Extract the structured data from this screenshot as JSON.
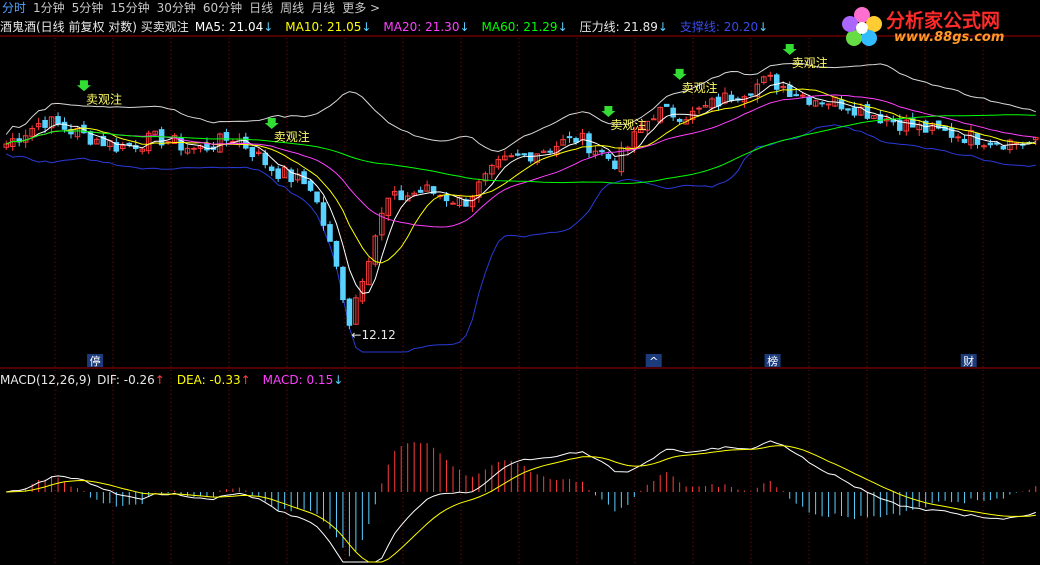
{
  "tabs": [
    "分时",
    "1分钟",
    "5分钟",
    "15分钟",
    "30分钟",
    "60分钟",
    "日线",
    "周线",
    "月线",
    "更多 >"
  ],
  "active_tab": "分时",
  "legend": {
    "security": "酒鬼酒(日线 前复权 对数) 买卖观注",
    "ma5": "MA5: 21.04",
    "ma10": "MA10: 21.05",
    "ma20": "MA20: 21.30",
    "ma60": "MA60: 21.29",
    "pressure": "压力线: 21.89",
    "support": "支撑线: 20.20"
  },
  "macd_legend": {
    "name": "MACD(12,26,9)",
    "dif": "DIF: -0.26",
    "dea": "DEA: -0.33",
    "macd": "MACD: 0.15"
  },
  "logo": {
    "name": "分析家公式网",
    "url": "www.88gs.com"
  },
  "colors": {
    "ma5": "#ffffff",
    "ma10": "#ffff00",
    "ma20": "#ff40ff",
    "ma60": "#00ff00",
    "upper_band": "#d8d8d8",
    "support": "#2a3ad8",
    "up": "#ff3b3b",
    "down": "#5ad2ff",
    "signal": "#33dd33",
    "axis": "#a00000"
  },
  "chart_data": [
    {
      "type": "candlestick",
      "title": "酒鬼酒(日线 前复权 对数) 买卖观注",
      "count": 160,
      "seed_path": [
        21.0,
        22.6,
        21.6,
        20.8,
        21.4,
        20.6,
        21.5,
        19.4,
        18.4,
        12.12,
        17.6,
        18.2,
        17.5,
        19.8,
        20.6,
        21.4,
        19.8,
        23.2,
        23.0,
        24.4,
        25.6,
        24.3,
        23.8,
        22.8,
        22.0,
        21.6,
        21.2,
        21.0
      ],
      "min_label": "←12.12",
      "signal_label": "卖观注",
      "signal_positions": [
        13,
        45,
        102,
        114,
        132
      ],
      "bottom_markers": [
        {
          "label": "停",
          "pos": 16
        },
        {
          "label": "^",
          "pos": 110
        },
        {
          "label": "榜",
          "pos": 130
        },
        {
          "label": "财",
          "pos": 163
        }
      ],
      "series": [
        {
          "name": "MA5"
        },
        {
          "name": "MA10"
        },
        {
          "name": "MA20"
        },
        {
          "name": "MA60"
        },
        {
          "name": "压力线"
        },
        {
          "name": "支撑线"
        }
      ]
    },
    {
      "type": "bar",
      "title": "MACD(12,26,9)",
      "series": [
        {
          "name": "DIF",
          "last": -0.26
        },
        {
          "name": "DEA",
          "last": -0.33
        },
        {
          "name": "MACD",
          "last": 0.15
        }
      ]
    }
  ]
}
